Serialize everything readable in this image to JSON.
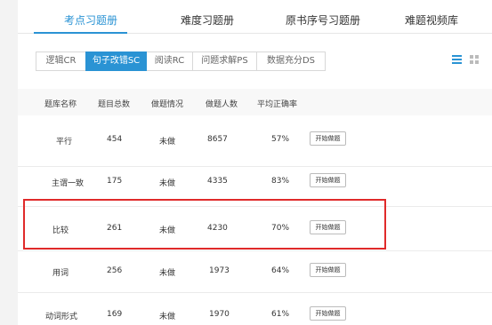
{
  "tabs": [
    {
      "label": "考点习题册"
    },
    {
      "label": "难度习题册"
    },
    {
      "label": "原书序号习题册"
    },
    {
      "label": "难题视频库"
    }
  ],
  "filters": [
    {
      "label": "逻辑CR"
    },
    {
      "label": "句子改错SC"
    },
    {
      "label": "阅读RC"
    },
    {
      "label": "问题求解PS"
    },
    {
      "label": "数据充分DS"
    }
  ],
  "table": {
    "headers": [
      "题库名称",
      "题目总数",
      "做题情况",
      "做题人数",
      "平均正确率"
    ],
    "rows": [
      {
        "name": "平行",
        "total": "454",
        "status": "未做",
        "count": "8657",
        "rate": "57%",
        "action": "开始做题"
      },
      {
        "name": "主谓一致",
        "total": "175",
        "status": "未做",
        "count": "4335",
        "rate": "83%",
        "action": "开始做题"
      },
      {
        "name": "比较",
        "total": "261",
        "status": "未做",
        "count": "4230",
        "rate": "70%",
        "action": "开始做题"
      },
      {
        "name": "用词",
        "total": "256",
        "status": "未做",
        "count": "1973",
        "rate": "64%",
        "action": "开始做题"
      },
      {
        "name": "动词形式",
        "total": "169",
        "status": "未做",
        "count": "1970",
        "rate": "61%",
        "action": "开始做题"
      }
    ]
  },
  "colors": {
    "accent": "#2a93d4",
    "highlight": "#e02a2a"
  }
}
